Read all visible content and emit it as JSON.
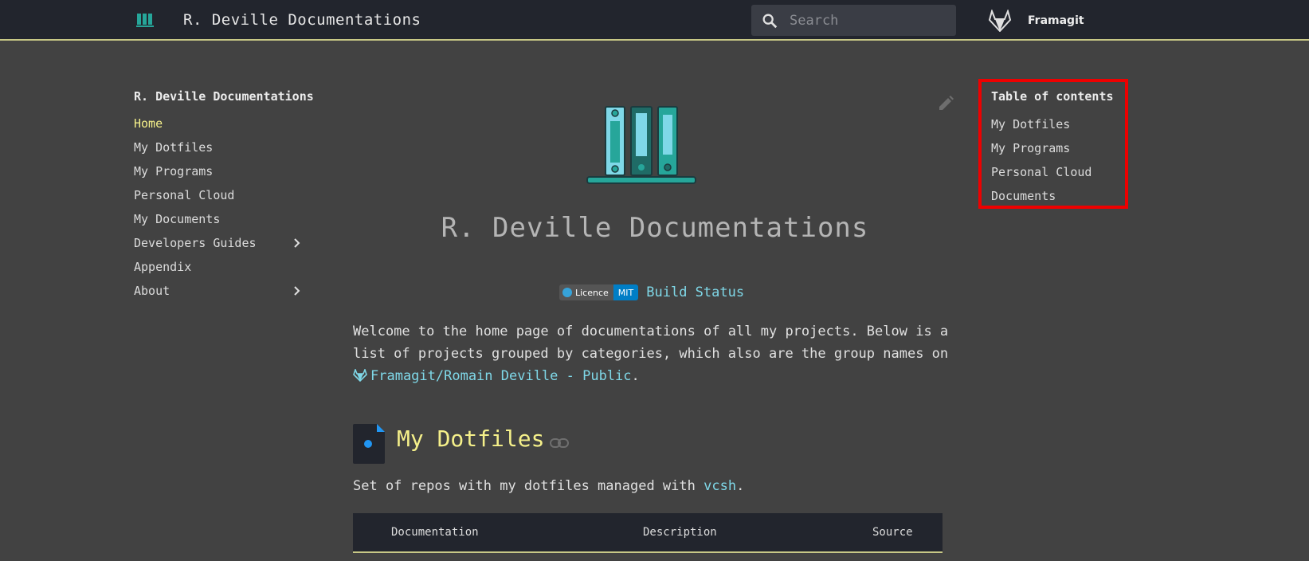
{
  "header": {
    "site_title": "R. Deville Documentations",
    "search_placeholder": "Search",
    "repo_name": "Framagit"
  },
  "nav": {
    "title": "R. Deville Documentations",
    "items": [
      {
        "label": "Home",
        "active": true
      },
      {
        "label": "My Dotfiles"
      },
      {
        "label": "My Programs"
      },
      {
        "label": "Personal Cloud"
      },
      {
        "label": "My Documents"
      },
      {
        "label": "Developers Guides",
        "expandable": true
      },
      {
        "label": "Appendix"
      },
      {
        "label": "About",
        "expandable": true
      }
    ]
  },
  "main": {
    "title": "R. Deville Documentations",
    "badge": {
      "left": "Licence",
      "right": "MIT"
    },
    "build_status": "Build Status",
    "intro_text": "Welcome to the home page of documentations of all my projects. Below is a list of projects grouped by categories, which also are the group names on ",
    "intro_link": "Framagit/Romain Deville - Public",
    "intro_end": ".",
    "section": {
      "title": "My Dotfiles",
      "desc_text": "Set of repos with my dotfiles managed with ",
      "desc_link": "vcsh",
      "desc_end": "."
    },
    "table": {
      "headers": [
        "Documentation",
        "Description",
        "Source"
      ]
    }
  },
  "toc": {
    "title": "Table of contents",
    "items": [
      "My Dotfiles",
      "My Programs",
      "Personal Cloud",
      "Documents"
    ]
  },
  "colors": {
    "header_bg": "#22252d",
    "body_bg": "#424242",
    "accent_yellow": "#f5f08a",
    "link_cyan": "#7fd8e8",
    "toc_highlight": "#ee0000"
  }
}
